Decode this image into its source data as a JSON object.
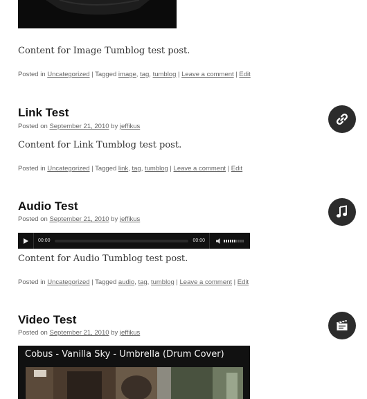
{
  "posts": [
    {
      "content": "Content for Image Tumblog test post.",
      "footer": {
        "posted_in": "Posted in",
        "category": "Uncategorized",
        "sep1": "|",
        "tagged": "Tagged",
        "tags": [
          "image",
          "tag",
          "tumblog"
        ],
        "sep2": "|",
        "comment": "Leave a comment",
        "sep3": "|",
        "edit": "Edit"
      }
    },
    {
      "title": "Link Test",
      "posted_on": "Posted on",
      "date": "September 21, 2010",
      "by": "by",
      "author": "jeffikus",
      "content": "Content for Link Tumblog test post.",
      "icon": "link-icon",
      "footer": {
        "posted_in": "Posted in",
        "category": "Uncategorized",
        "sep1": "|",
        "tagged": "Tagged",
        "tags": [
          "link",
          "tag",
          "tumblog"
        ],
        "sep2": "|",
        "comment": "Leave a comment",
        "sep3": "|",
        "edit": "Edit"
      }
    },
    {
      "title": "Audio Test",
      "posted_on": "Posted on",
      "date": "September 21, 2010",
      "by": "by",
      "author": "jeffikus",
      "content": "Content for Audio Tumblog test post.",
      "icon": "music-note-icon",
      "player": {
        "current_time": "00:00",
        "duration": "00:00",
        "progress": 0,
        "volume": 0.8
      },
      "footer": {
        "posted_in": "Posted in",
        "category": "Uncategorized",
        "sep1": "|",
        "tagged": "Tagged",
        "tags": [
          "audio",
          "tag",
          "tumblog"
        ],
        "sep2": "|",
        "comment": "Leave a comment",
        "sep3": "|",
        "edit": "Edit"
      }
    },
    {
      "title": "Video Test",
      "posted_on": "Posted on",
      "date": "September 21, 2010",
      "by": "by",
      "author": "jeffikus",
      "icon": "clapperboard-icon",
      "video_title": "Cobus - Vanilla Sky - Umbrella (Drum Cover)"
    }
  ],
  "colors": {
    "icon_bg": "#2c2c2c",
    "player_bg": "#111111",
    "link": "#666666"
  }
}
